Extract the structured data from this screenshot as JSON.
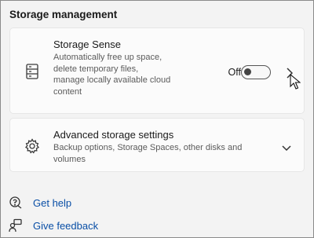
{
  "section": {
    "title": "Storage management"
  },
  "storage_sense": {
    "title": "Storage Sense",
    "description": "Automatically free up space, delete temporary files, manage locally available cloud content",
    "toggle_label": "Off",
    "toggle_on": false
  },
  "advanced": {
    "title": "Advanced storage settings",
    "description": "Backup options, Storage Spaces, other disks and volumes"
  },
  "links": {
    "help": "Get help",
    "feedback": "Give feedback"
  },
  "icons": {
    "storage_sense": "storage-drive-icon",
    "advanced": "gear-icon",
    "help": "help-headset-icon",
    "feedback": "feedback-person-icon"
  },
  "colors": {
    "link": "#0a4fa6",
    "background": "#f3f3f3",
    "card": "#fbfbfb"
  }
}
